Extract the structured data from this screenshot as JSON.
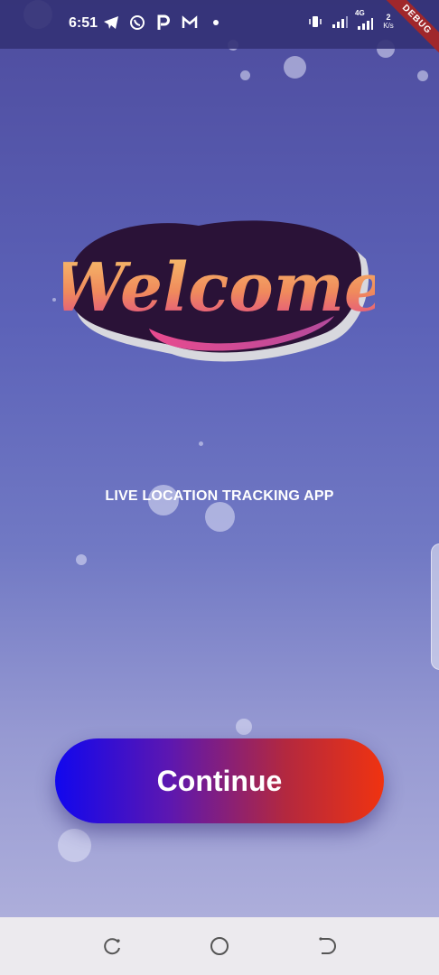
{
  "status_bar": {
    "time": "6:51",
    "left_icons": [
      "telegram-icon",
      "whatsapp-icon",
      "p-app-icon",
      "gmail-icon",
      "dot-icon"
    ],
    "right_icons": [
      "vibrate-icon",
      "signal-icon",
      "signal-4g-icon",
      "network-speed-icon",
      "battery-icon"
    ],
    "network_label": "4G",
    "speed_value": "2",
    "speed_unit": "K/s"
  },
  "debug_banner": "DEBUG",
  "logo": {
    "text": "Welcome"
  },
  "subtitle": "LIVE LOCATION TRACKING APP",
  "continue_button": {
    "label": "Continue"
  },
  "nav_bar": {
    "buttons": [
      "recent-apps",
      "home",
      "back"
    ]
  },
  "colors": {
    "background_top": "#4e4c9e",
    "background_bottom": "#adaedb",
    "button_start": "#1107ee",
    "button_end": "#f03310"
  }
}
